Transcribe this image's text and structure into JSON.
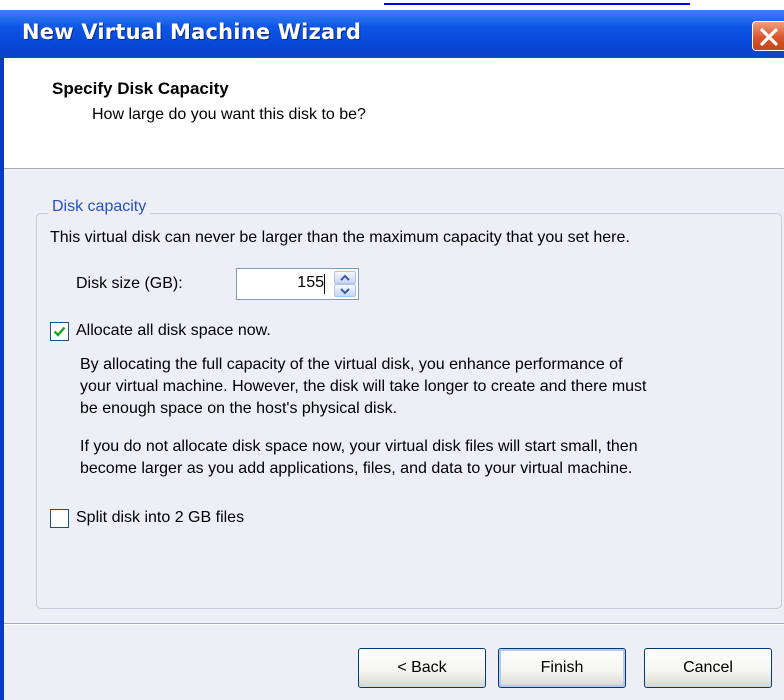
{
  "window": {
    "title": "New Virtual Machine Wizard"
  },
  "header": {
    "title": "Specify Disk Capacity",
    "subtitle": "How large do you want this disk to be?"
  },
  "disk_capacity": {
    "legend": "Disk capacity",
    "description": "This virtual disk can never be larger than the maximum capacity that you set here.",
    "size_label": "Disk size (GB):",
    "size_value": "155"
  },
  "allocate": {
    "label": "Allocate all disk space now.",
    "checked": true,
    "para1": [
      "By allocating the full capacity of the virtual disk, you enhance performance of",
      "your virtual machine.  However, the disk will take longer to create and there must",
      "be enough space on the host's physical disk."
    ],
    "para2": [
      "If you do not allocate disk space now, your virtual disk files will start small, then",
      "become larger as you add applications, files, and data to your virtual machine."
    ]
  },
  "split": {
    "label": "Split disk into 2 GB files",
    "checked": false
  },
  "buttons": {
    "back": "< Back",
    "finish": "Finish",
    "cancel": "Cancel"
  },
  "icons": {
    "close": "close-icon",
    "spin_up": "chevron-up-icon",
    "spin_down": "chevron-down-icon",
    "check": "checkmark-icon"
  }
}
